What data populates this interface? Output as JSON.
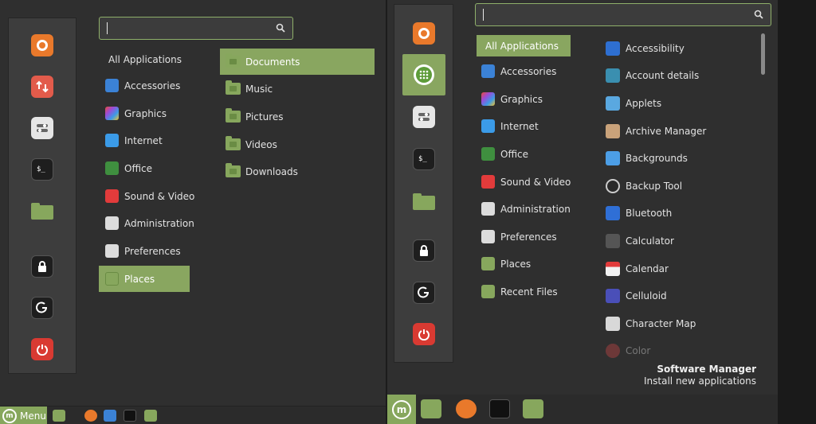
{
  "left_menu": {
    "categories": [
      {
        "label": "All Applications"
      },
      {
        "label": "Accessories"
      },
      {
        "label": "Graphics"
      },
      {
        "label": "Internet"
      },
      {
        "label": "Office"
      },
      {
        "label": "Sound & Video"
      },
      {
        "label": "Administration"
      },
      {
        "label": "Preferences"
      },
      {
        "label": "Places"
      }
    ],
    "places": [
      {
        "label": "Documents"
      },
      {
        "label": "Music"
      },
      {
        "label": "Pictures"
      },
      {
        "label": "Videos"
      },
      {
        "label": "Downloads"
      }
    ]
  },
  "left_panel": {
    "menu_label": "Menu"
  },
  "right_menu": {
    "categories": [
      {
        "label": "All Applications"
      },
      {
        "label": "Accessories"
      },
      {
        "label": "Graphics"
      },
      {
        "label": "Internet"
      },
      {
        "label": "Office"
      },
      {
        "label": "Sound & Video"
      },
      {
        "label": "Administration"
      },
      {
        "label": "Preferences"
      },
      {
        "label": "Places"
      },
      {
        "label": "Recent Files"
      }
    ],
    "apps": [
      {
        "label": "Accessibility"
      },
      {
        "label": "Account details"
      },
      {
        "label": "Applets"
      },
      {
        "label": "Archive Manager"
      },
      {
        "label": "Backgrounds"
      },
      {
        "label": "Backup Tool"
      },
      {
        "label": "Bluetooth"
      },
      {
        "label": "Calculator"
      },
      {
        "label": "Calendar"
      },
      {
        "label": "Celluloid"
      },
      {
        "label": "Character Map"
      },
      {
        "label": "Color"
      }
    ],
    "info": {
      "title": "Software Manager",
      "subtitle": "Install new applications"
    }
  },
  "colors": {
    "accent": "#89a660",
    "folder": "#87a75d",
    "menu_bg": "#2f2f2f",
    "sidebar_bg": "#3d3d3d"
  }
}
